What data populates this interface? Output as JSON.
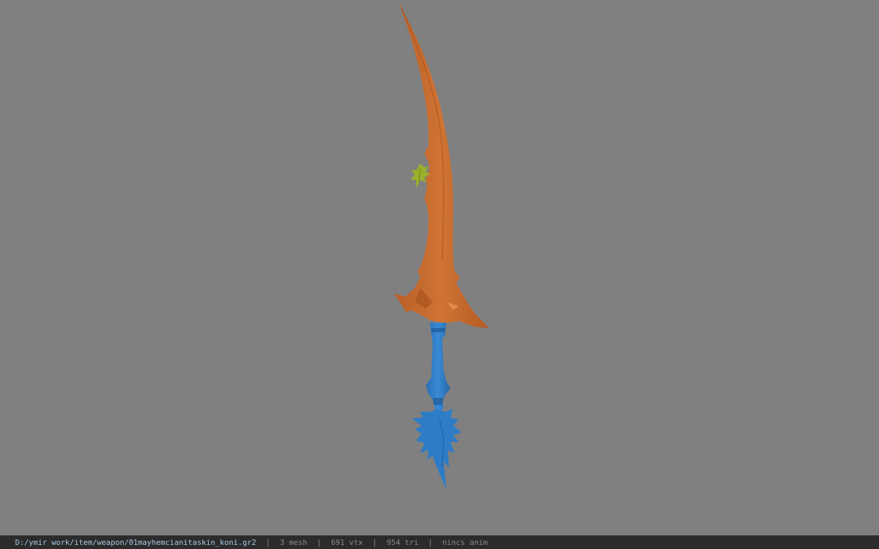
{
  "viewer": {
    "background_color": "#808080",
    "model": {
      "blade_color": "#c76a2e",
      "leaf_color": "#9ab02a",
      "handle_color": "#2e7cc6"
    }
  },
  "status_bar": {
    "file_path": "D:/ymir work/item/weapon/01mayhemcianitaskin_koni.gr2",
    "separator": "|",
    "mesh_count": "3 mesh",
    "vertex_count": "691 vtx",
    "triangle_count": "954 tri",
    "animation": "nincs anim"
  }
}
